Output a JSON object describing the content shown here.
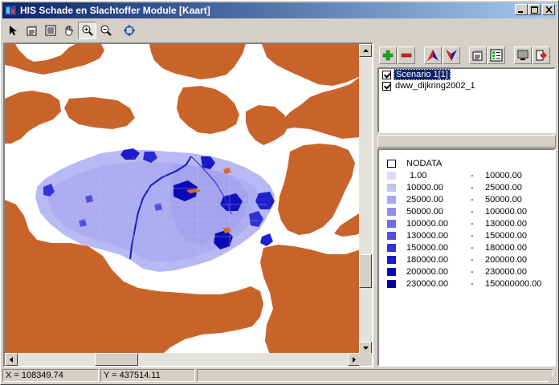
{
  "window": {
    "title": "HIS Schade en Slachtoffer Module [Kaart]",
    "controls": {
      "minimize": "_",
      "maximize": "□",
      "close": "×"
    }
  },
  "toolbar": {
    "tools": [
      {
        "name": "select-arrow-icon",
        "pressed": false
      },
      {
        "name": "properties-icon",
        "pressed": false
      },
      {
        "name": "full-extent-icon",
        "pressed": false
      },
      {
        "name": "pan-hand-icon",
        "pressed": false
      },
      {
        "name": "zoom-in-icon",
        "pressed": true
      },
      {
        "name": "zoom-out-icon",
        "pressed": false
      },
      {
        "name": "refresh-icon",
        "pressed": false
      }
    ]
  },
  "map": {
    "colors": {
      "land": "#c8642a",
      "water": "#ffffff",
      "damage_base": "#b4b4f4"
    }
  },
  "layers": {
    "items": [
      {
        "label": "Scenario 1[1]",
        "checked": true,
        "selected": true
      },
      {
        "label": "dww_dijkring2002_1",
        "checked": true,
        "selected": false
      }
    ]
  },
  "legend": {
    "nodata_label": "NODATA",
    "rows": [
      {
        "from": "1.00",
        "to": "10000.00",
        "color": "#dcdcf8"
      },
      {
        "from": "10000.00",
        "to": "25000.00",
        "color": "#c4c4f4"
      },
      {
        "from": "25000.00",
        "to": "50000.00",
        "color": "#a8a8f0"
      },
      {
        "from": "50000.00",
        "to": "100000.00",
        "color": "#9090ec"
      },
      {
        "from": "100000.00",
        "to": "130000.00",
        "color": "#7070e4"
      },
      {
        "from": "130000.00",
        "to": "150000.00",
        "color": "#5050dc"
      },
      {
        "from": "150000.00",
        "to": "180000.00",
        "color": "#3434d4"
      },
      {
        "from": "180000.00",
        "to": "200000.00",
        "color": "#1818cc"
      },
      {
        "from": "200000.00",
        "to": "230000.00",
        "color": "#0808b8"
      },
      {
        "from": "230000.00",
        "to": "150000000.00",
        "color": "#0000a0"
      }
    ],
    "separator": "-"
  },
  "status": {
    "x": "X = 108349.74",
    "y": "Y = 437514.11",
    "extra": ""
  }
}
